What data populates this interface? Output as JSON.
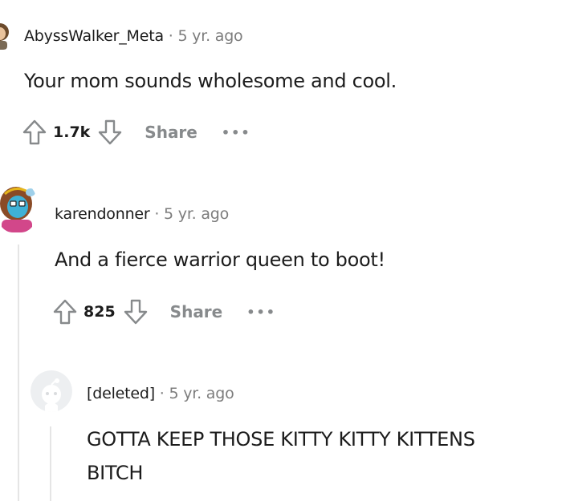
{
  "comments": [
    {
      "author": "AbyssWalker_Meta",
      "separator": "·",
      "time": "5 yr. ago",
      "body": "Your mom sounds wholesome and cool.",
      "score": "1.7k",
      "share_label": "Share",
      "more_label": "•••"
    },
    {
      "author": "karendonner",
      "separator": "·",
      "time": "5 yr. ago",
      "body": "And a fierce warrior queen to boot!",
      "score": "825",
      "share_label": "Share",
      "more_label": "•••"
    },
    {
      "author": "[deleted]",
      "separator": "·",
      "time": "5 yr. ago",
      "body_lines": [
        "GOTTA KEEP THOSE KITTY KITTY KITTENS",
        "BITCH"
      ]
    }
  ],
  "icons": {
    "upvote": "upvote-arrow-icon",
    "downvote": "downvote-arrow-icon",
    "more": "more-options-icon"
  },
  "colors": {
    "muted": "#878a8c",
    "thread_line": "#e5e5e5",
    "text": "#1c1c1c"
  }
}
